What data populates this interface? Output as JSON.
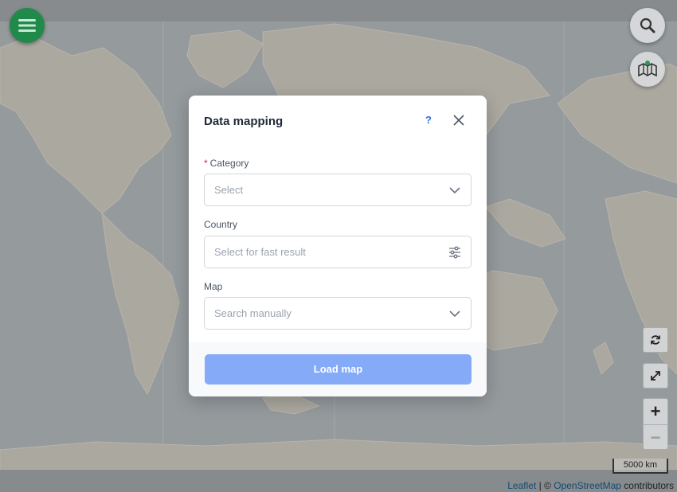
{
  "map": {
    "scale_label": "5000 km",
    "attribution": {
      "leaflet": "Leaflet",
      "separator": " | © ",
      "osm": "OpenStreetMap",
      "suffix": " contributors"
    },
    "colors": {
      "ocean": "#9ea3a6",
      "land": "#b5b1a8",
      "menu_fab": "#1f8a4a"
    }
  },
  "controls": {
    "menu_icon": "hamburger-icon",
    "search_icon": "search-icon",
    "layers_icon": "map-layers-icon",
    "refresh_icon": "refresh-icon",
    "fullscreen_icon": "expand-icon",
    "zoom_in": "+",
    "zoom_out": "−"
  },
  "modal": {
    "title": "Data mapping",
    "help": "?",
    "category": {
      "required_mark": "*",
      "label": "Category",
      "placeholder": "Select"
    },
    "country": {
      "label": "Country",
      "placeholder": "Select for fast result"
    },
    "map": {
      "label": "Map",
      "placeholder": "Search manually"
    },
    "load_button": "Load map",
    "accent": "#85aaf7"
  }
}
